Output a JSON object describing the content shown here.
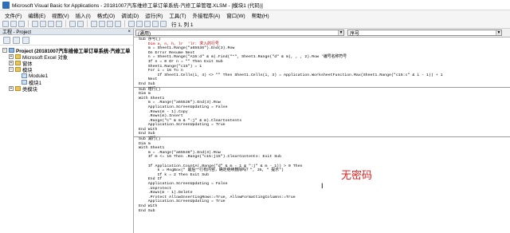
{
  "window": {
    "title": "Microsoft Visual Basic for Applications - 20181007汽车维修工单订单系统-汽修工单管理.XLSM - [模块1 (代码)]"
  },
  "menu": [
    "文件(F)",
    "编辑(E)",
    "视图(V)",
    "插入(I)",
    "格式(O)",
    "调试(D)",
    "运行(R)",
    "工具(T)",
    "外接程序(A)",
    "窗口(W)",
    "帮助(H)"
  ],
  "toolbar": {
    "position": "行 1, 列 1"
  },
  "project": {
    "header": "工程 - Project",
    "close": "×",
    "tree": [
      {
        "label": "Project (20181007汽车维修工单订单系统-汽修工单",
        "indent": 0,
        "toggle": "−",
        "icon": "pi",
        "bold": true
      },
      {
        "label": "Microsoft Excel 对象",
        "indent": 1,
        "toggle": "+",
        "icon": "fi",
        "bold": false
      },
      {
        "label": "窗体",
        "indent": 1,
        "toggle": "+",
        "icon": "fi",
        "bold": false
      },
      {
        "label": "模块",
        "indent": 1,
        "toggle": "−",
        "icon": "fi",
        "bold": false
      },
      {
        "label": "Module1",
        "indent": 2,
        "toggle": "",
        "icon": "mi2",
        "bold": false
      },
      {
        "label": "模块1",
        "indent": 2,
        "toggle": "",
        "icon": "mi2",
        "bold": false
      },
      {
        "label": "类模块",
        "indent": 1,
        "toggle": "+",
        "icon": "fi",
        "bold": false
      }
    ]
  },
  "code_window": {
    "object_combo": "(通用)",
    "proc_combo": "序号",
    "lines": [
      {
        "t": "Sub 序号()",
        "c": ""
      },
      {
        "t": "    Dim a, n, h, lr  'lr: 求入的行号",
        "c": "cm"
      },
      {
        "t": "    m = Sheet1.Range(\"a65536\").End(3).Row",
        "c": ""
      },
      {
        "t": "    On Error Resume Next",
        "c": ""
      },
      {
        "t": "    n = Sheet1.Range(\"A15:d\" & m).Find(\"*\", Sheet1.Range(\"d\" & m), , , 2).Row '编号名称符号",
        "c": ""
      },
      {
        "t": "    If n = 0 Or n = \"\" Then Exit Sub",
        "c": ""
      },
      {
        "t": "    Sheet1.Range(\"c15\") = 1",
        "c": ""
      },
      {
        "t": "    For i = 16 To n",
        "c": ""
      },
      {
        "t": "        If Sheet1.Cells(i, 4) <> \"\" Then Sheet1.Cells(i, 3) = Application.WorksheetFunction.Max(Sheet1.Range(\"c15:c\" & i - 1)) + 1",
        "c": ""
      },
      {
        "t": "    Next",
        "c": ""
      },
      {
        "t": "End Sub",
        "c": ""
      },
      {
        "t": "",
        "c": "sep"
      },
      {
        "t": "Sub 增行()",
        "c": ""
      },
      {
        "t": "Dim m",
        "c": ""
      },
      {
        "t": "With Sheet1",
        "c": ""
      },
      {
        "t": "    m = .Range(\"a65536\").End(3).Row",
        "c": ""
      },
      {
        "t": "    Application.ScreenUpdating = False",
        "c": ""
      },
      {
        "t": "    .Rows(m - 1).Copy",
        "c": ""
      },
      {
        "t": "    .Rows(m).Insert",
        "c": ""
      },
      {
        "t": "    .Range(\"c\" & m & \":j\" & m).ClearContents",
        "c": ""
      },
      {
        "t": "    Application.ScreenUpdating = True",
        "c": ""
      },
      {
        "t": "End With",
        "c": ""
      },
      {
        "t": "End Sub",
        "c": ""
      },
      {
        "t": "",
        "c": "sep"
      },
      {
        "t": "Sub 减行()",
        "c": ""
      },
      {
        "t": "Dim m",
        "c": ""
      },
      {
        "t": "With Sheet1",
        "c": ""
      },
      {
        "t": "    m = .Range(\"a65536\").End(3).Row",
        "c": ""
      },
      {
        "t": "    If m <= 16 Then .Range(\"c15:j15\").ClearContents: Exit Sub",
        "c": ""
      },
      {
        "t": "",
        "c": ""
      },
      {
        "t": "    If Application.CountA(.Range(\"d\" & m - 1 & \":j\" & m - 1)) > 0 Then",
        "c": ""
      },
      {
        "t": "        k = MsgBox(\" 最后一行有内容，确定继续删除吗？\", 35, \" 提示\")",
        "c": ""
      },
      {
        "t": "        If k = 2 Then Exit Sub",
        "c": ""
      },
      {
        "t": "    End If",
        "c": ""
      },
      {
        "t": "    Application.ScreenUpdating = False",
        "c": ""
      },
      {
        "t": "    .Unprotect",
        "c": ""
      },
      {
        "t": "    .Rows(m - 1).Delete",
        "c": ""
      },
      {
        "t": "    .Protect AllowInsertingRows:=True, AllowFormattingColumns:=True",
        "c": ""
      },
      {
        "t": "    Application.ScreenUpdating = True",
        "c": ""
      },
      {
        "t": "End With",
        "c": ""
      },
      {
        "t": "End Sub",
        "c": ""
      }
    ]
  },
  "annotation": "无密码",
  "colors": {
    "annotation": "#e02020",
    "comment": "#c00000"
  }
}
